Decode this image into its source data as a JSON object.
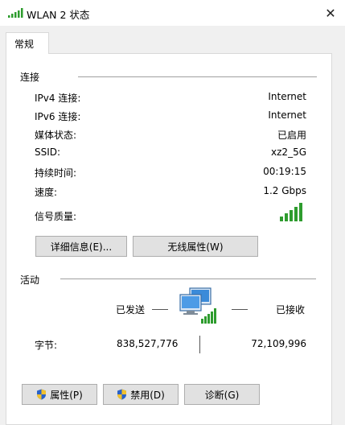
{
  "window": {
    "title": "WLAN 2 状态",
    "close_glyph": "✕"
  },
  "tab": {
    "label": "常规"
  },
  "connection": {
    "heading": "连接",
    "rows": [
      {
        "label": "IPv4 连接:",
        "value": "Internet"
      },
      {
        "label": "IPv6 连接:",
        "value": "Internet"
      },
      {
        "label": "媒体状态:",
        "value": "已启用"
      },
      {
        "label": "SSID:",
        "value": "xz2_5G"
      },
      {
        "label": "持续时间:",
        "value": "00:19:15"
      },
      {
        "label": "速度:",
        "value": "1.2 Gbps"
      }
    ],
    "signal_label": "信号质量:",
    "signal_bars": 5
  },
  "buttons": {
    "details": "详细信息(E)...",
    "wireless_props": "无线属性(W)"
  },
  "activity": {
    "heading": "活动",
    "sent_label": "已发送",
    "received_label": "已接收",
    "bytes_label": "字节:",
    "bytes_sent": "838,527,776",
    "bytes_received": "72,109,996"
  },
  "footer": {
    "properties": "属性(P)",
    "disable": "禁用(D)",
    "diagnose": "诊断(G)"
  },
  "colors": {
    "signal_green": "#2e9c2e",
    "shield_blue": "#2a62c9",
    "shield_yellow": "#f2c12e"
  }
}
